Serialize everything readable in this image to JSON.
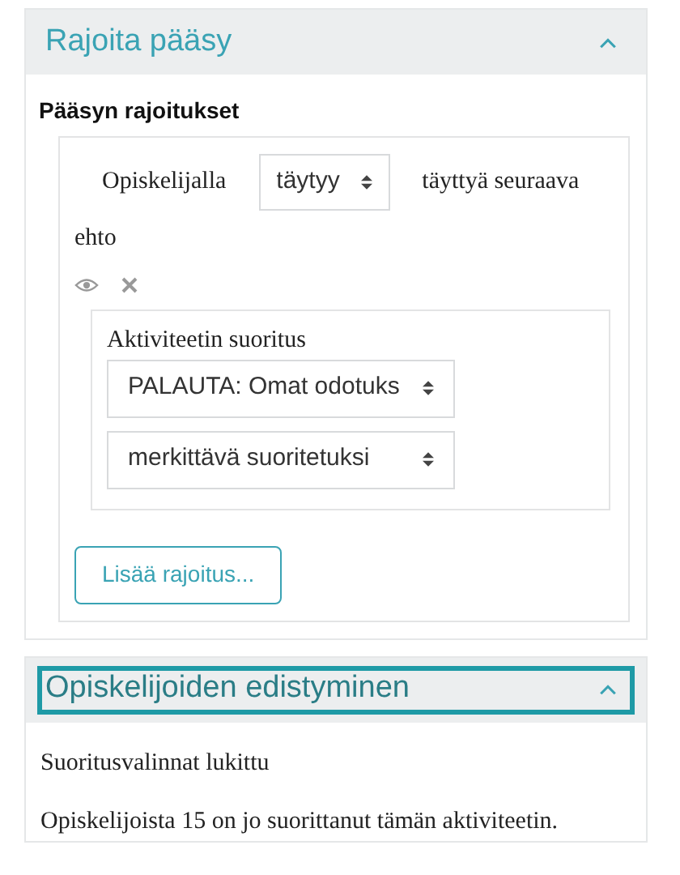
{
  "sections": [
    {
      "kind": "restrict",
      "title": "Rajoita pääsy",
      "expanded": true,
      "focused": false,
      "heading": "Pääsyn rajoitukset",
      "lead": "Opiskelijalla",
      "mode_select": "täytyy",
      "trail": "täyttyä seuraava",
      "trail_2": "ehto",
      "condition": {
        "title": "Aktiviteetin suoritus",
        "selects": [
          "PALAUTA: Omat odotuks",
          "merkittävä suoritetuksi"
        ]
      },
      "add_button": "Lisää rajoitus..."
    },
    {
      "kind": "text",
      "title": "Opiskelijoiden edistyminen",
      "expanded": true,
      "focused": true,
      "paragraphs": [
        "Suoritusvalinnat lukittu",
        "Opiskelijoista 15 on jo suorittanut tämän aktiviteetin."
      ]
    }
  ]
}
